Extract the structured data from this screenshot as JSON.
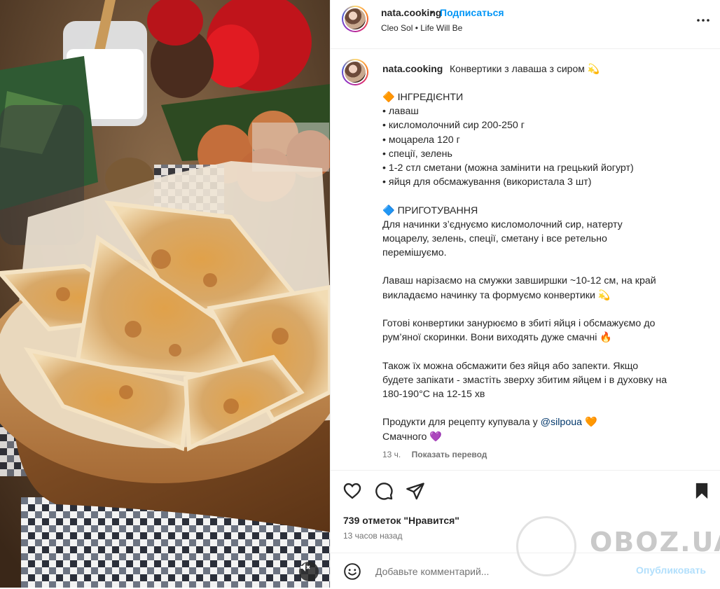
{
  "header": {
    "username": "nata.cooking",
    "separator": "•",
    "follow_label": "Подписаться",
    "music_artist": "Cleo Sol",
    "music_separator": "•",
    "music_track": "Life Will Be"
  },
  "caption": {
    "username": "nata.cooking",
    "title": "Конвертики з лаваша з сиром 💫",
    "lines": [
      "🔶 ІНГРЕДІЄНТИ",
      "• лаваш",
      "• кисломолочний сир 200-250 г",
      "• моцарела 120 г",
      "• спеції, зелень",
      "• 1-2 стл сметани (можна замінити на грецький йогурт)",
      "• яйця для обсмажування (використала 3 шт)",
      "",
      "🔷 ПРИГОТУВАННЯ",
      "Для начинки з’єднуємо кисломолочний сир, натерту",
      "моцарелу, зелень, спеції, сметану і все ретельно",
      "перемішуємо.",
      "",
      "Лаваш нарізаємо на смужки завширшки ~10-12 см, на край",
      "викладаємо начинку та формуємо конвертики 💫",
      "",
      "Готові конвертики занурюємо в збиті яйця і обсмажуємо до",
      "рум’яної скоринки. Вони виходять дуже смачні 🔥",
      "",
      "Також їх можна обсмажити без яйця або запекти. Якщо",
      "будете запікати - змастіть зверху збитим яйцем і в духовку на",
      "180-190°С на 12-15 хв",
      ""
    ],
    "products_prefix": "Продукти для рецепту купувала у ",
    "products_mention": "@silpoua",
    "products_suffix": " 🧡",
    "closing": "Смачного 💜",
    "age": "13 ч.",
    "translate_label": "Показать перевод"
  },
  "actions": {
    "likes": "739 отметок \"Нравится\"",
    "posted": "13 часов назад"
  },
  "comment": {
    "placeholder": "Добавьте комментарий...",
    "post_label": "Опубликовать"
  },
  "watermark": "OBOZ.UA",
  "colors": {
    "accent": "#0095f6",
    "post_disabled": "#b2dffc",
    "text": "#262626",
    "muted": "#737373"
  }
}
